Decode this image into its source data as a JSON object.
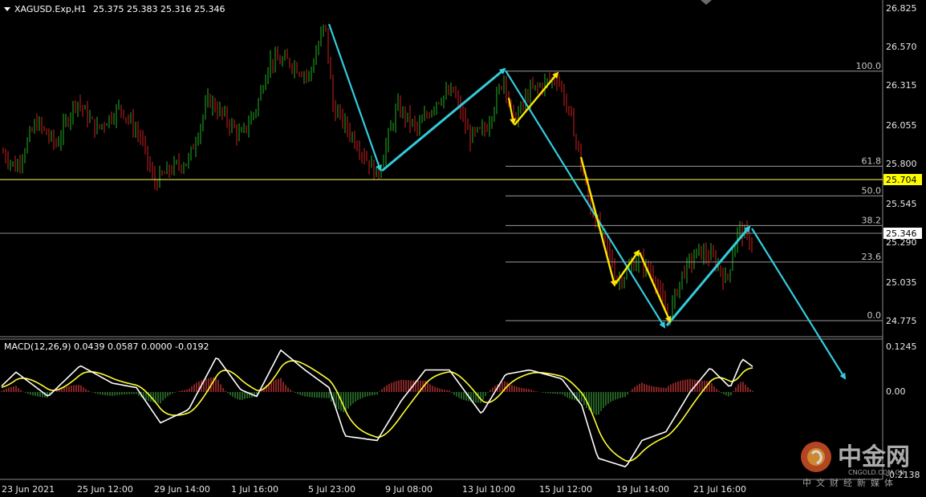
{
  "header": {
    "symbol": "XAGUSD.Exp,H1",
    "ohlc": "25.375 25.383 25.316 25.346"
  },
  "macd": {
    "label": "MACD(12,26,9) 0.0439 0.0587 0.0000 -0.0192",
    "y_ticks": [
      "0.1245",
      "0.00",
      "-0.2138"
    ]
  },
  "price_axis": {
    "ticks": [
      "26.825",
      "26.570",
      "26.315",
      "26.055",
      "25.800",
      "25.545",
      "25.290",
      "25.035",
      "24.775"
    ],
    "ylim": [
      24.7,
      26.85
    ],
    "marker_current": "25.346",
    "marker_line": "25.704"
  },
  "time_axis": {
    "ticks": [
      "23 Jun 2021",
      "25 Jun 12:00",
      "29 Jun 14:00",
      "1 Jul 16:00",
      "5 Jul 23:00",
      "9 Jul 08:00",
      "13 Jul 10:00",
      "15 Jul 12:00",
      "19 Jul 14:00",
      "21 Jul 16:00"
    ]
  },
  "fibonacci": {
    "levels": [
      {
        "label": "100.0",
        "price": 26.435
      },
      {
        "label": "61.8",
        "price": 25.81
      },
      {
        "label": "50.0",
        "price": 25.615
      },
      {
        "label": "38.2",
        "price": 25.42
      },
      {
        "label": "23.6",
        "price": 25.18
      },
      {
        "label": "0.0",
        "price": 24.795
      }
    ]
  },
  "colors": {
    "background": "#000000",
    "bull": "#22b022",
    "bear": "#d02020",
    "wave_arrow": "#33ccdd",
    "sub_arrow": "#ffe600",
    "macd_main": "#ffffff",
    "macd_signal": "#ffff33",
    "hist_pos": "#b03030",
    "hist_neg": "#2e7d2e"
  },
  "chart_data": {
    "type": "line",
    "ylim": [
      24.7,
      26.85
    ],
    "x": [
      "23 Jun 2021",
      "25 Jun 12:00",
      "29 Jun 14:00",
      "1 Jul 16:00",
      "5 Jul 23:00",
      "9 Jul 08:00",
      "13 Jul 10:00",
      "15 Jul 12:00",
      "19 Jul 14:00",
      "21 Jul 16:00"
    ],
    "series": [
      {
        "values": [
          25.9,
          26.2,
          25.85,
          26.3,
          26.6,
          25.75,
          26.45,
          26.3,
          24.8,
          25.35
        ]
      }
    ],
    "wave_path": [
      {
        "x": "5 Jul 23:00",
        "y": 26.77
      },
      {
        "x": "9 Jul 08:00",
        "y": 25.73
      },
      {
        "x": "13 Jul 10:00",
        "y": 26.435
      },
      {
        "x": "19 Jul 14:00",
        "y": 24.775
      },
      {
        "x": "21 Jul 16:00",
        "y": 25.4
      },
      {
        "x": "",
        "y": 24.25
      }
    ],
    "grid": false
  },
  "watermark": {
    "brand": "中金网",
    "url": "CNGOLD.COM.CN",
    "tagline": "中文财经新媒体"
  }
}
